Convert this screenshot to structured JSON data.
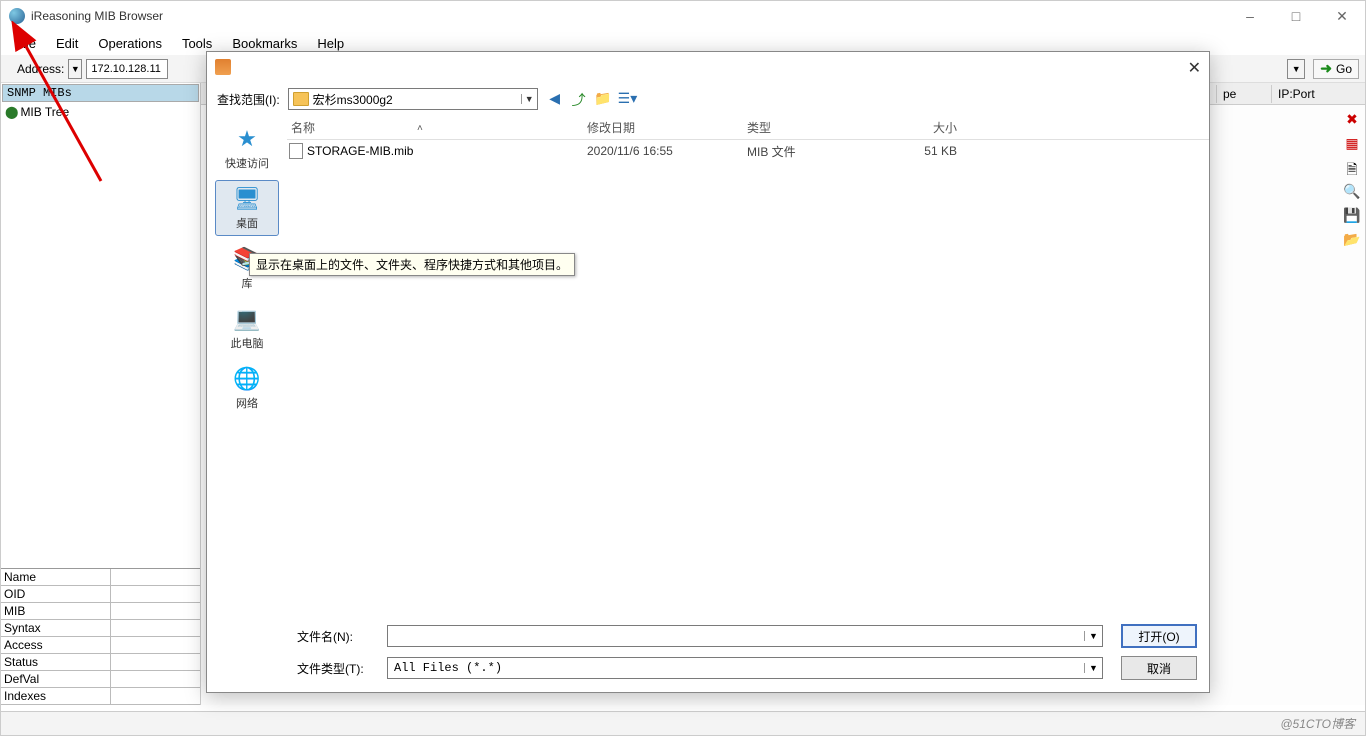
{
  "app": {
    "title": "iReasoning MIB Browser"
  },
  "menus": {
    "file": "File",
    "edit": "Edit",
    "operations": "Operations",
    "tools": "Tools",
    "bookmarks": "Bookmarks",
    "help": "Help"
  },
  "toolbar": {
    "address_label": "Address:",
    "address_value": "172.10.128.11",
    "go_label": "Go"
  },
  "tree": {
    "header": "SNMP MIBs",
    "root_label": "MIB Tree"
  },
  "props": {
    "name": "Name",
    "oid": "OID",
    "mib": "MIB",
    "syntax": "Syntax",
    "access": "Access",
    "status": "Status",
    "defval": "DefVal",
    "indexes": "Indexes"
  },
  "right_table": {
    "col_type": "pe",
    "col_ipport": "IP:Port"
  },
  "dialog": {
    "range_label": "查找范围(I):",
    "range_value": "宏杉ms3000g2",
    "places": {
      "quick": "快速访问",
      "desktop": "桌面",
      "library": "库",
      "pc": "此电脑",
      "network": "网络"
    },
    "cols": {
      "name": "名称",
      "date": "修改日期",
      "type": "类型",
      "size": "大小"
    },
    "files": [
      {
        "name": "STORAGE-MIB.mib",
        "date": "2020/11/6 16:55",
        "type": "MIB 文件",
        "size": "51 KB"
      }
    ],
    "filename_label": "文件名(N):",
    "filetype_label": "文件类型(T):",
    "filetype_value": "All Files (*.*)",
    "open_btn": "打开(O)",
    "cancel_btn": "取消",
    "tooltip": "显示在桌面上的文件、文件夹、程序快捷方式和其他项目。"
  },
  "watermark": "@51CTO博客"
}
